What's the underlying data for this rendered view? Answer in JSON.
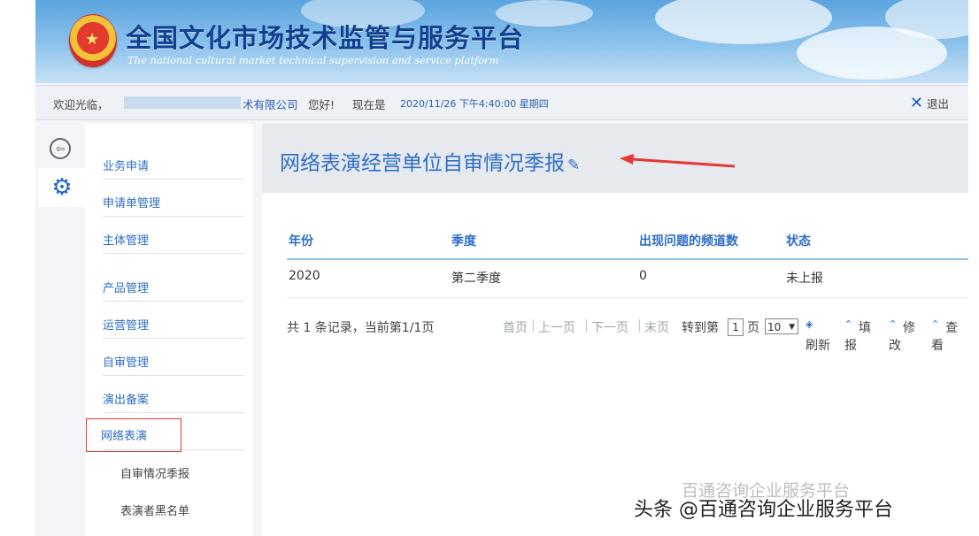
{
  "header": {
    "title": "全国文化市场技术监管与服务平台",
    "subtitle": "The national cultural market technical supervision and service platform",
    "emblem_icon": "national-emblem-icon"
  },
  "infobar": {
    "welcome": "欢迎光临，",
    "company_suffix": "术有限公司",
    "greeting": "您好!",
    "now_label": "现在是",
    "datetime": "2020/11/26 下午4:40:00 星期四",
    "logout": "退出"
  },
  "rail": {
    "back_icon": "back-arrow-icon",
    "settings_icon": "gear-icon"
  },
  "sidebar": {
    "items": [
      {
        "label": "业务申请"
      },
      {
        "label": "申请单管理"
      },
      {
        "label": "主体管理"
      },
      {
        "label": "产品管理"
      },
      {
        "label": "运营管理"
      },
      {
        "label": "自审管理"
      },
      {
        "label": "演出备案"
      },
      {
        "label": "网络表演"
      }
    ],
    "subitems": [
      {
        "label": "自审情况季报"
      },
      {
        "label": "表演者黑名单"
      }
    ]
  },
  "main": {
    "title": "网络表演经营单位自审情况季报",
    "edit_icon": "edit-icon",
    "table": {
      "headers": [
        "年份",
        "季度",
        "出现问题的频道数",
        "状态"
      ],
      "rows": [
        [
          "2020",
          "第二季度",
          "0",
          "未上报"
        ]
      ]
    },
    "pager": {
      "records": "共 1 条记录，当前第1/1页",
      "first": "首页",
      "prev": "上一页",
      "next": "下一页",
      "last": "末页",
      "goto_label": "转到第",
      "page_value": "1",
      "page_unit": "页",
      "page_size": "10",
      "refresh": "刷新",
      "fill": "填报",
      "modify": "修改",
      "view": "查看"
    }
  },
  "watermark": {
    "text": "头条 @百通咨询企业服务平台",
    "ghost": "百通咨询企业服务平台"
  },
  "colors": {
    "accent": "#2d6ec7",
    "highlight_box": "#e53935",
    "header_title": "#123f8f"
  }
}
